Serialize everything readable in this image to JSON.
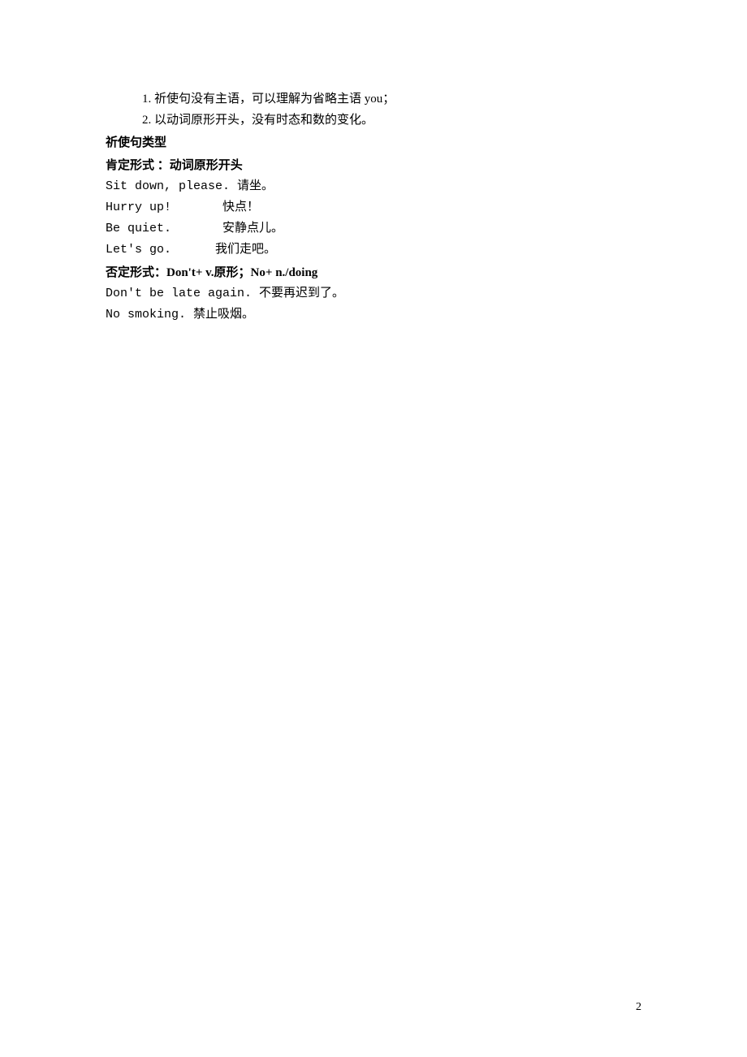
{
  "points": {
    "p1": "1.  祈使句没有主语，可以理解为省略主语 you；",
    "p2": "2. 以动词原形开头，没有时态和数的变化。"
  },
  "section": {
    "types_heading": "祈使句类型",
    "affirmative_heading": "肯定形式 ：动词原形开头",
    "ex1": "Sit down, please. 请坐。",
    "ex2": "Hurry up!       快点！",
    "ex3": "Be quiet.       安静点儿。",
    "ex4": "Let's go.      我们走吧。",
    "negative_heading": "否定形式：Don't+ v.原形；No+ n./doing",
    "ex5": "Don't be late again. 不要再迟到了。",
    "ex6": "No smoking. 禁止吸烟。"
  },
  "page_number": "2"
}
